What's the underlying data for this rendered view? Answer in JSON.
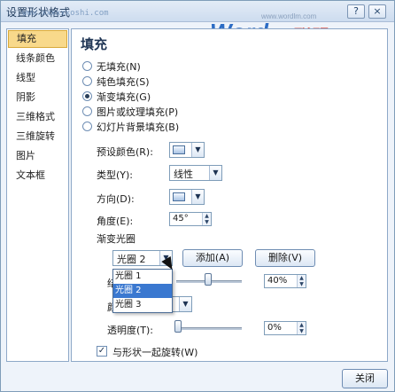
{
  "window": {
    "title": "设置形状格式",
    "watermark": "www.xxxxxxoshi.com",
    "brand_url": "www.wordlm.com",
    "brand_word": "Word",
    "brand_cn": "联盟",
    "min_label": "?",
    "close_label": "×"
  },
  "sidebar": {
    "items": [
      {
        "label": "填充"
      },
      {
        "label": "线条颜色"
      },
      {
        "label": "线型"
      },
      {
        "label": "阴影"
      },
      {
        "label": "三维格式"
      },
      {
        "label": "三维旋转"
      },
      {
        "label": "图片"
      },
      {
        "label": "文本框"
      }
    ]
  },
  "panel": {
    "heading": "填充",
    "fill_options": [
      {
        "label": "无填充(N)",
        "checked": false
      },
      {
        "label": "纯色填充(S)",
        "checked": false
      },
      {
        "label": "渐变填充(G)",
        "checked": true
      },
      {
        "label": "图片或纹理填充(P)",
        "checked": false
      },
      {
        "label": "幻灯片背景填充(B)",
        "checked": false
      }
    ],
    "preset_label": "预设颜色(R):",
    "type_label": "类型(Y):",
    "type_value": "线性",
    "direction_label": "方向(D):",
    "angle_label": "角度(E):",
    "angle_value": "45°",
    "stops_label": "渐变光圈",
    "stop_select_value": "光圈 2",
    "add_button": "添加(A)",
    "delete_button": "删除(V)",
    "stop_pos_label": "结",
    "stop_pos_value": "40%",
    "stop_color_label": "颜",
    "transparency_label": "透明度(T):",
    "transparency_value": "0%",
    "rotate_with_shape_label": "与形状一起旋转(W)",
    "rotate_with_shape_checked": true,
    "dropdown_options": [
      "光圈 1",
      "光圈 2",
      "光圈 3"
    ],
    "dropdown_selected": "光圈 2"
  },
  "footer": {
    "close_button": "关闭"
  }
}
